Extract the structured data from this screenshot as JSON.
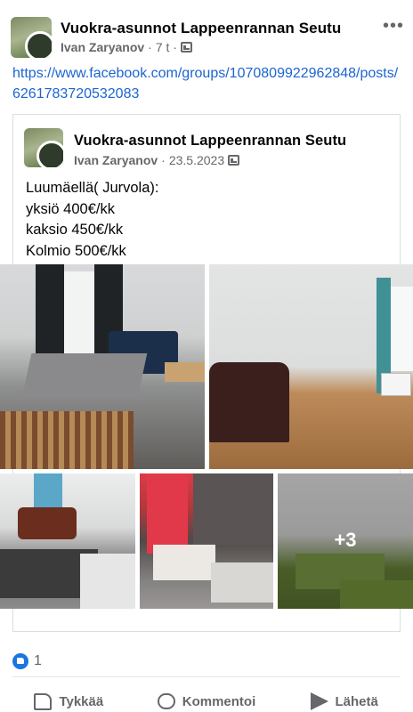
{
  "post": {
    "group_name": "Vuokra-asunnot Lappeenrannan Seutu",
    "author": "Ivan Zaryanov",
    "time": "7 t",
    "separator": "·",
    "link": "https://www.facebook.com/groups/1070809922962848/posts/6261783720532083",
    "more_icon": "•••"
  },
  "shared": {
    "group_name": "Vuokra-asunnot Lappeenrannan Seutu",
    "author": "Ivan Zaryanov",
    "date": "23.5.2023",
    "separator": "·",
    "text_lines": [
      "Luumäellä( Jurvola):",
      "yksiö 400€/kk",
      "kaksio 450€/kk",
      "Kolmio 500€/kk"
    ],
    "more_photos": "+3"
  },
  "reactions": {
    "count": "1"
  },
  "actions": {
    "like": "Tykkää",
    "comment": "Kommentoi",
    "share": "Lähetä"
  },
  "colors": {
    "link": "#1b65d1",
    "like_blue": "#1b74e4",
    "muted": "#65676b"
  }
}
